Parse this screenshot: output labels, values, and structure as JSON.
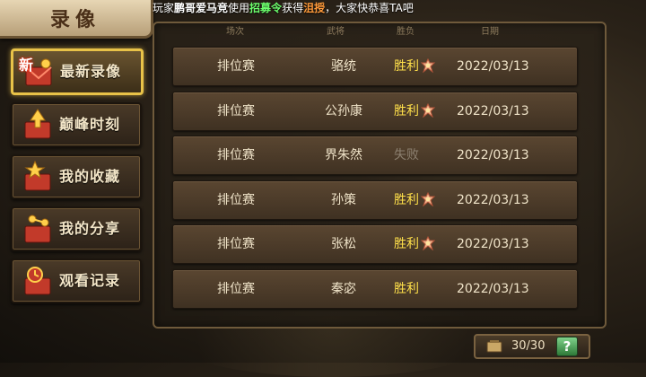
{
  "title": "录像",
  "announcement": {
    "prefix": "玩家",
    "player": "鹏哥爱马竞",
    "mid1": "使用",
    "item": "招募令",
    "mid2": "获得",
    "reward": "沮授",
    "suffix": "，大家快恭喜TA吧"
  },
  "menu": [
    {
      "label": "最新录像",
      "icon": "newest-replay-icon",
      "badge": "新",
      "active": true
    },
    {
      "label": "巅峰时刻",
      "icon": "peak-moment-icon",
      "active": false
    },
    {
      "label": "我的收藏",
      "icon": "favorites-star-icon",
      "active": false
    },
    {
      "label": "我的分享",
      "icon": "share-icon",
      "active": false
    },
    {
      "label": "观看记录",
      "icon": "history-icon",
      "active": false
    }
  ],
  "columns": [
    "场次",
    "武将",
    "胜负",
    "日期"
  ],
  "rows": [
    {
      "mode": "排位赛",
      "general": "骆统",
      "result": "胜利",
      "win": true,
      "mvp": true,
      "date": "2022/03/13"
    },
    {
      "mode": "排位赛",
      "general": "公孙康",
      "result": "胜利",
      "win": true,
      "mvp": true,
      "date": "2022/03/13"
    },
    {
      "mode": "排位赛",
      "general": "界朱然",
      "result": "失败",
      "win": false,
      "mvp": false,
      "date": "2022/03/13"
    },
    {
      "mode": "排位赛",
      "general": "孙策",
      "result": "胜利",
      "win": true,
      "mvp": true,
      "date": "2022/03/13"
    },
    {
      "mode": "排位赛",
      "general": "张松",
      "result": "胜利",
      "win": true,
      "mvp": true,
      "date": "2022/03/13"
    },
    {
      "mode": "排位赛",
      "general": "秦宓",
      "result": "胜利",
      "win": true,
      "mvp": false,
      "date": "2022/03/13"
    }
  ],
  "pager": {
    "text": "30/30",
    "help": "?"
  },
  "colors": {
    "accent_gold": "#e8c248",
    "win": "#ffe04a",
    "lose": "#8c8070",
    "help_green": "#2e7a38"
  }
}
